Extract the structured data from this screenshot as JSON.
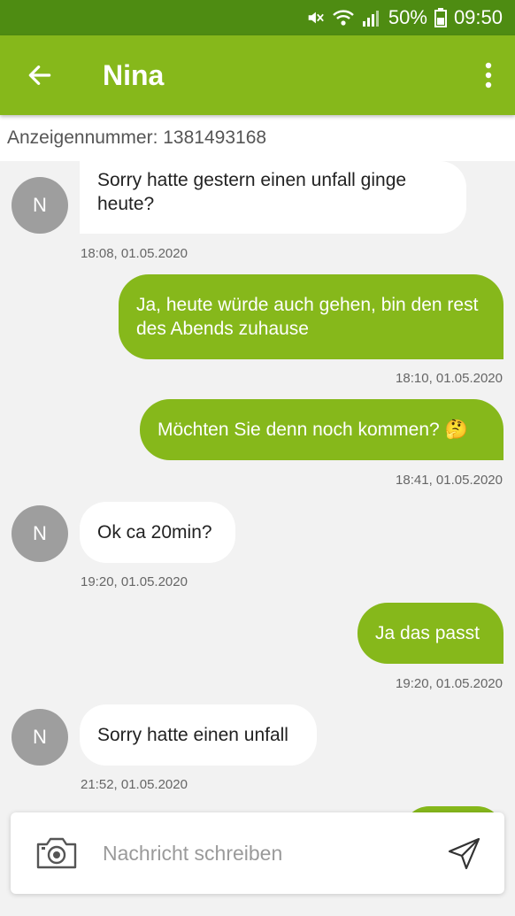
{
  "status_bar": {
    "battery": "50%",
    "time": "09:50",
    "icons": [
      "mute-icon",
      "wifi-icon",
      "signal-icon",
      "battery-icon"
    ]
  },
  "header": {
    "title": "Nina",
    "back_icon": "arrow-left-icon",
    "menu_icon": "more-vert-icon"
  },
  "listing": {
    "ad_number": "Anzeigennummer: 1381493168"
  },
  "messages": [
    {
      "sender": "in",
      "avatar": "N",
      "text": "Sorry hatte gestern einen unfall ginge heute?",
      "time": "18:08, 01.05.2020"
    },
    {
      "sender": "out",
      "text": "Ja, heute würde auch gehen, bin den rest des Abends zuhause",
      "time": "18:10, 01.05.2020"
    },
    {
      "sender": "out",
      "text": "Möchten Sie denn noch kommen? 🤔",
      "time": "18:41, 01.05.2020"
    },
    {
      "sender": "in",
      "avatar": "N",
      "text": "Ok ca 20min?",
      "time": "19:20, 01.05.2020"
    },
    {
      "sender": "out",
      "text": "Ja das passt",
      "time": "19:20, 01.05.2020"
    },
    {
      "sender": "in",
      "avatar": "N",
      "text": "Sorry hatte einen unfall",
      "time": "21:52, 01.05.2020"
    }
  ],
  "composer": {
    "placeholder": "Nachricht schreiben",
    "camera_icon": "camera-icon",
    "send_icon": "send-icon"
  },
  "colors": {
    "status_bar": "#4e8c12",
    "app_bar": "#86b81b",
    "outgoing_bubble": "#86b81b",
    "incoming_bubble": "#ffffff",
    "avatar": "#9e9e9e",
    "background": "#f2f2f2"
  }
}
